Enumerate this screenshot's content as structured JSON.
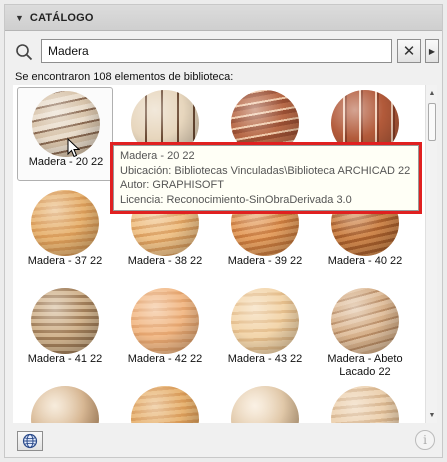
{
  "header": {
    "title": "CATÁLOGO"
  },
  "search": {
    "value": "Madera"
  },
  "result_count": "Se encontraron 108 elementos de biblioteca:",
  "tiles": [
    {
      "label": "Madera - 20 22",
      "texture": "stripes-light"
    },
    {
      "label": "",
      "texture": "segments-pale"
    },
    {
      "label": "",
      "texture": "stripes-red"
    },
    {
      "label": "",
      "texture": "segments-red"
    },
    {
      "label": "Madera - 37 22",
      "texture": "grain-light"
    },
    {
      "label": "Madera - 38 22",
      "texture": "grain-golden"
    },
    {
      "label": "Madera - 39 22",
      "texture": "grain-orange"
    },
    {
      "label": "Madera - 40 22",
      "texture": "grain-dark"
    },
    {
      "label": "Madera - 41 22",
      "texture": "plaid"
    },
    {
      "label": "Madera - 42 22",
      "texture": "grain-peach"
    },
    {
      "label": "Madera - 43 22",
      "texture": "grain-cream"
    },
    {
      "label": "Madera - Abeto Lacado 22",
      "texture": "grain-fir"
    },
    {
      "label": "",
      "texture": "speckle"
    },
    {
      "label": "",
      "texture": "grain-light"
    },
    {
      "label": "",
      "texture": "speckle-light"
    },
    {
      "label": "",
      "texture": "grain-pale"
    }
  ],
  "tooltip": {
    "name": "Madera - 20 22",
    "location": "Ubicación: Bibliotecas Vinculadas\\Biblioteca ARCHICAD 22",
    "author": "Autor: GRAPHISOFT",
    "license": "Licencia: Reconocimiento-SinObraDerivada 3.0"
  },
  "icons": {
    "search": "search-icon",
    "clear": "close-icon",
    "nav": "chevron-right-icon",
    "globe": "globe-icon",
    "info": "info-icon"
  },
  "footer": {
    "info_glyph": "i"
  },
  "colors": {
    "tooltip_highlight": "#e02020",
    "panel_header": "#d4d4d4"
  }
}
